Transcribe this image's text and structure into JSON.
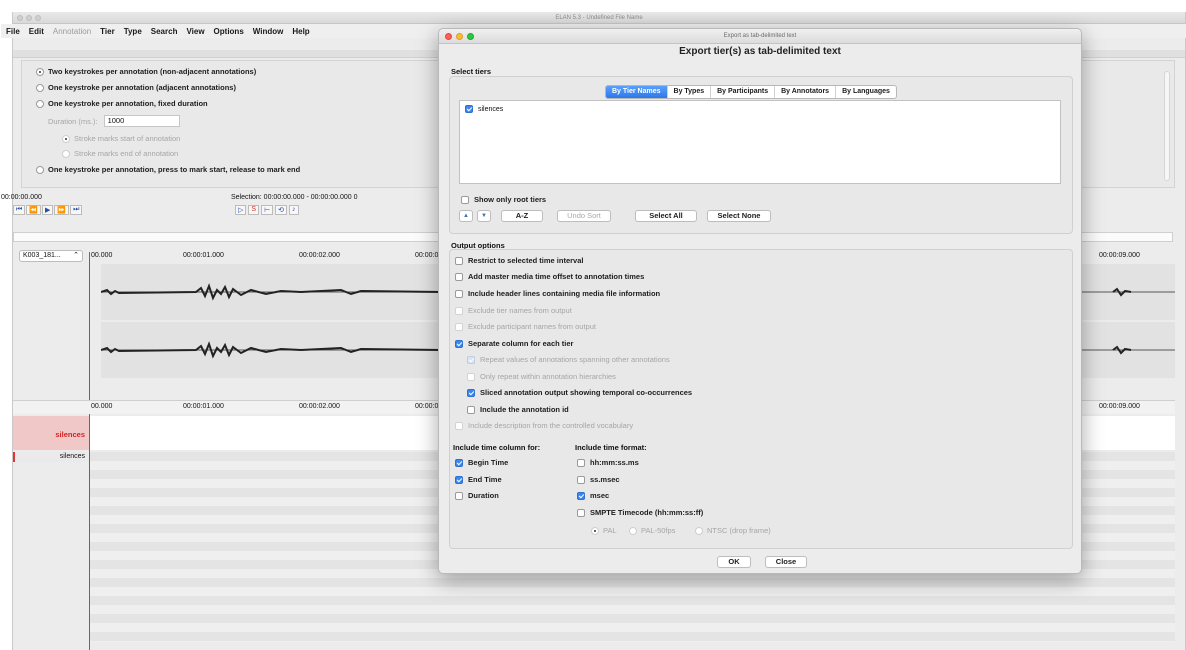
{
  "window": {
    "title": "ELAN 5.3 - Undefined File Name"
  },
  "menu": [
    "File",
    "Edit",
    "Annotation",
    "Tier",
    "Type",
    "Search",
    "View",
    "Options",
    "Window",
    "Help"
  ],
  "segmentation": {
    "options": [
      "Two keystrokes per annotation (non-adjacent annotations)",
      "One keystroke per annotation (adjacent annotations)",
      "One keystroke per annotation, fixed duration"
    ],
    "duration_label": "Duration (ms.):",
    "duration_value": "1000",
    "sub_options": [
      "Stroke marks start of annotation",
      "Stroke marks end of annotation"
    ],
    "last_option": "One keystroke per annotation, press to mark start, release to mark end"
  },
  "media": {
    "time": "00:00:00.000",
    "selection": "Selection: 00:00:00.000 - 00:00:00.000  0"
  },
  "timeline": {
    "tier_selector": "K003_181...",
    "ticks": [
      "00.000",
      "00:00:01.000",
      "00:00:02.000",
      "00:00:0",
      "00:00:09.000"
    ]
  },
  "tiers": {
    "active": "silences",
    "list_item": "silences"
  },
  "dialog": {
    "window_title": "Export as tab-delimited text",
    "heading": "Export tier(s) as tab-delimited text",
    "select_tiers_label": "Select tiers",
    "tabs": [
      "By Tier Names",
      "By Types",
      "By Participants",
      "By Annotators",
      "By Languages"
    ],
    "tier_items": [
      "silences"
    ],
    "show_root": "Show only root tiers",
    "buttons": {
      "az": "A-Z",
      "undo_sort": "Undo Sort",
      "select_all": "Select All",
      "select_none": "Select None",
      "ok": "OK",
      "close": "Close"
    },
    "output_label": "Output options",
    "options": [
      {
        "label": "Restrict to selected time interval",
        "checked": false,
        "enabled": true
      },
      {
        "label": "Add master media time offset to annotation times",
        "checked": false,
        "enabled": true
      },
      {
        "label": "Include header lines containing media file information",
        "checked": false,
        "enabled": true
      },
      {
        "label": "Exclude tier names from output",
        "checked": false,
        "enabled": false
      },
      {
        "label": "Exclude participant names from output",
        "checked": false,
        "enabled": false
      },
      {
        "label": "Separate column for each tier",
        "checked": true,
        "enabled": true
      },
      {
        "label": "Repeat values of annotations spanning other annotations",
        "checked": true,
        "enabled": false
      },
      {
        "label": "Only repeat within annotation hierarchies",
        "checked": false,
        "enabled": false
      },
      {
        "label": "Sliced annotation output showing temporal co-occurrences",
        "checked": true,
        "enabled": true
      },
      {
        "label": "Include the annotation id",
        "checked": false,
        "enabled": true
      },
      {
        "label": "Include description from the controlled vocabulary",
        "checked": false,
        "enabled": false
      }
    ],
    "time_column_label": "Include time column for:",
    "time_columns": [
      {
        "label": "Begin Time",
        "checked": true
      },
      {
        "label": "End Time",
        "checked": true
      },
      {
        "label": "Duration",
        "checked": false
      }
    ],
    "time_format_label": "Include time format:",
    "time_formats": [
      {
        "label": "hh:mm:ss.ms",
        "checked": false
      },
      {
        "label": "ss.msec",
        "checked": false
      },
      {
        "label": "msec",
        "checked": true
      },
      {
        "label": "SMPTE Timecode (hh:mm:ss:ff)",
        "checked": false
      }
    ],
    "smpte_options": [
      "PAL",
      "PAL-50fps",
      "NTSC (drop frame)"
    ]
  }
}
